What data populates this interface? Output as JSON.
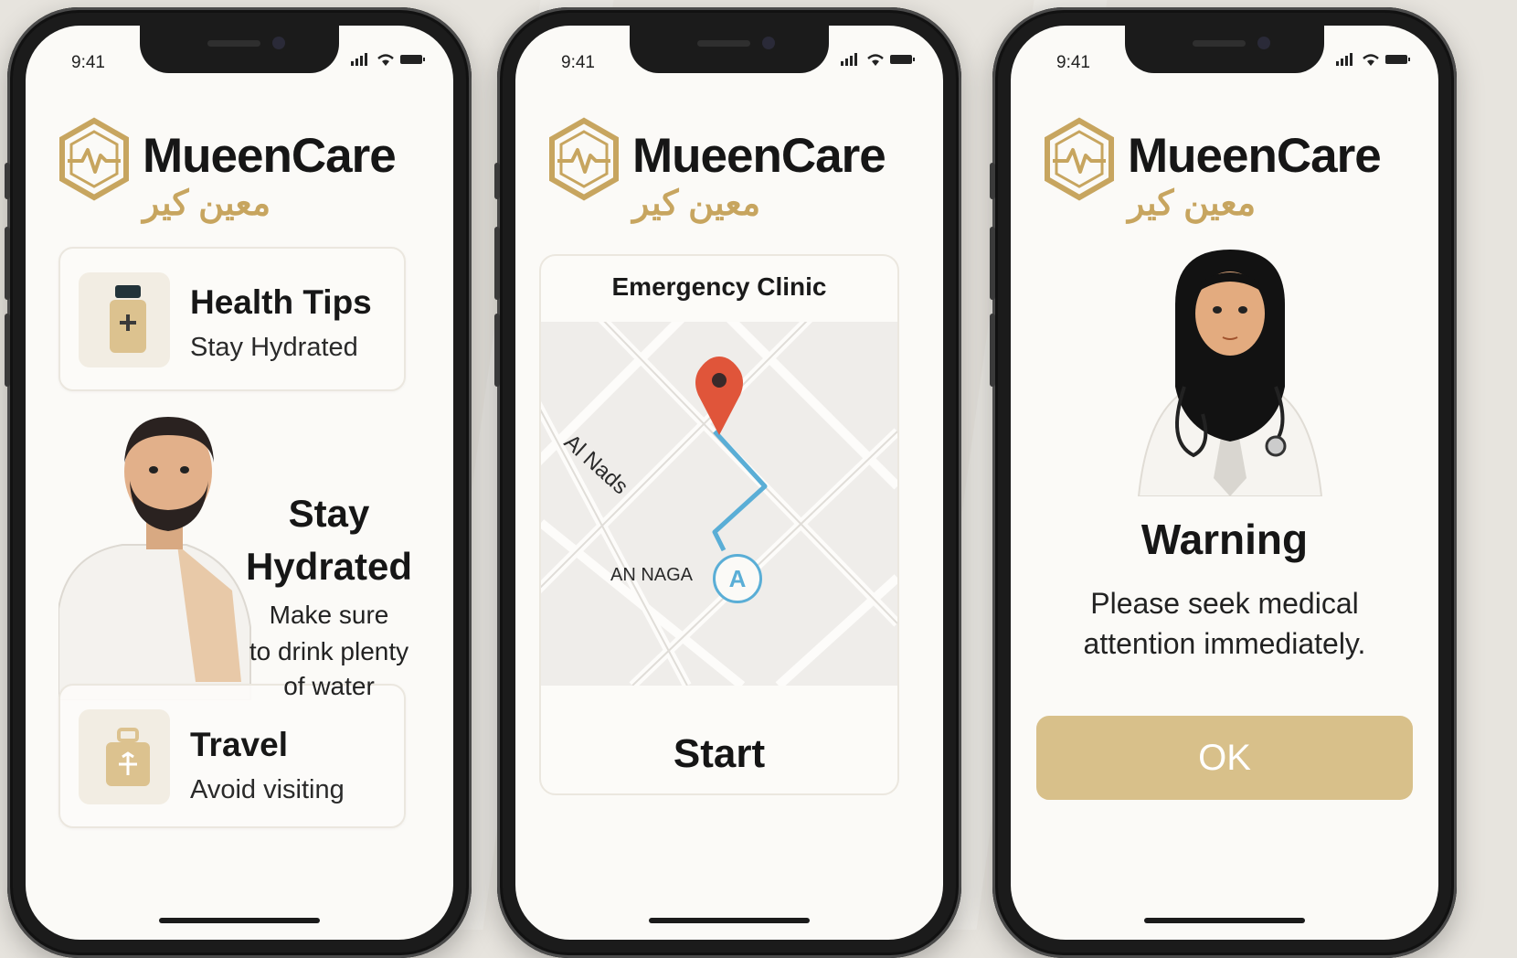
{
  "status_time": "9:41",
  "brand": {
    "name": "MueenCare",
    "arabic_name": "معين كير",
    "accent": "#c7a55f"
  },
  "screen1": {
    "card_health": {
      "title": "Health Tips",
      "subtitle": "Stay Hydrated",
      "icon": "water-bottle-icon"
    },
    "promo": {
      "title_line1": "Stay",
      "title_line2": "Hydrated",
      "body_line1": "Make sure",
      "body_line2": "to drink plenty",
      "body_line3": "of water"
    },
    "card_travel": {
      "title": "Travel",
      "subtitle": "Avoid visiting",
      "icon": "luggage-icon"
    }
  },
  "screen2": {
    "title": "Emergency Clinic",
    "map": {
      "street_label_1": "Al Nads",
      "street_label_2": "AN NAGA",
      "start_marker": "A",
      "route_color": "#5aaed6",
      "pin_color": "#e0553a"
    },
    "start_label": "Start"
  },
  "screen3": {
    "warning_title": "Warning",
    "warning_line1": "Please seek medical",
    "warning_line2": "attention immediately.",
    "ok_label": "OK",
    "ok_color": "#d8c08a"
  }
}
